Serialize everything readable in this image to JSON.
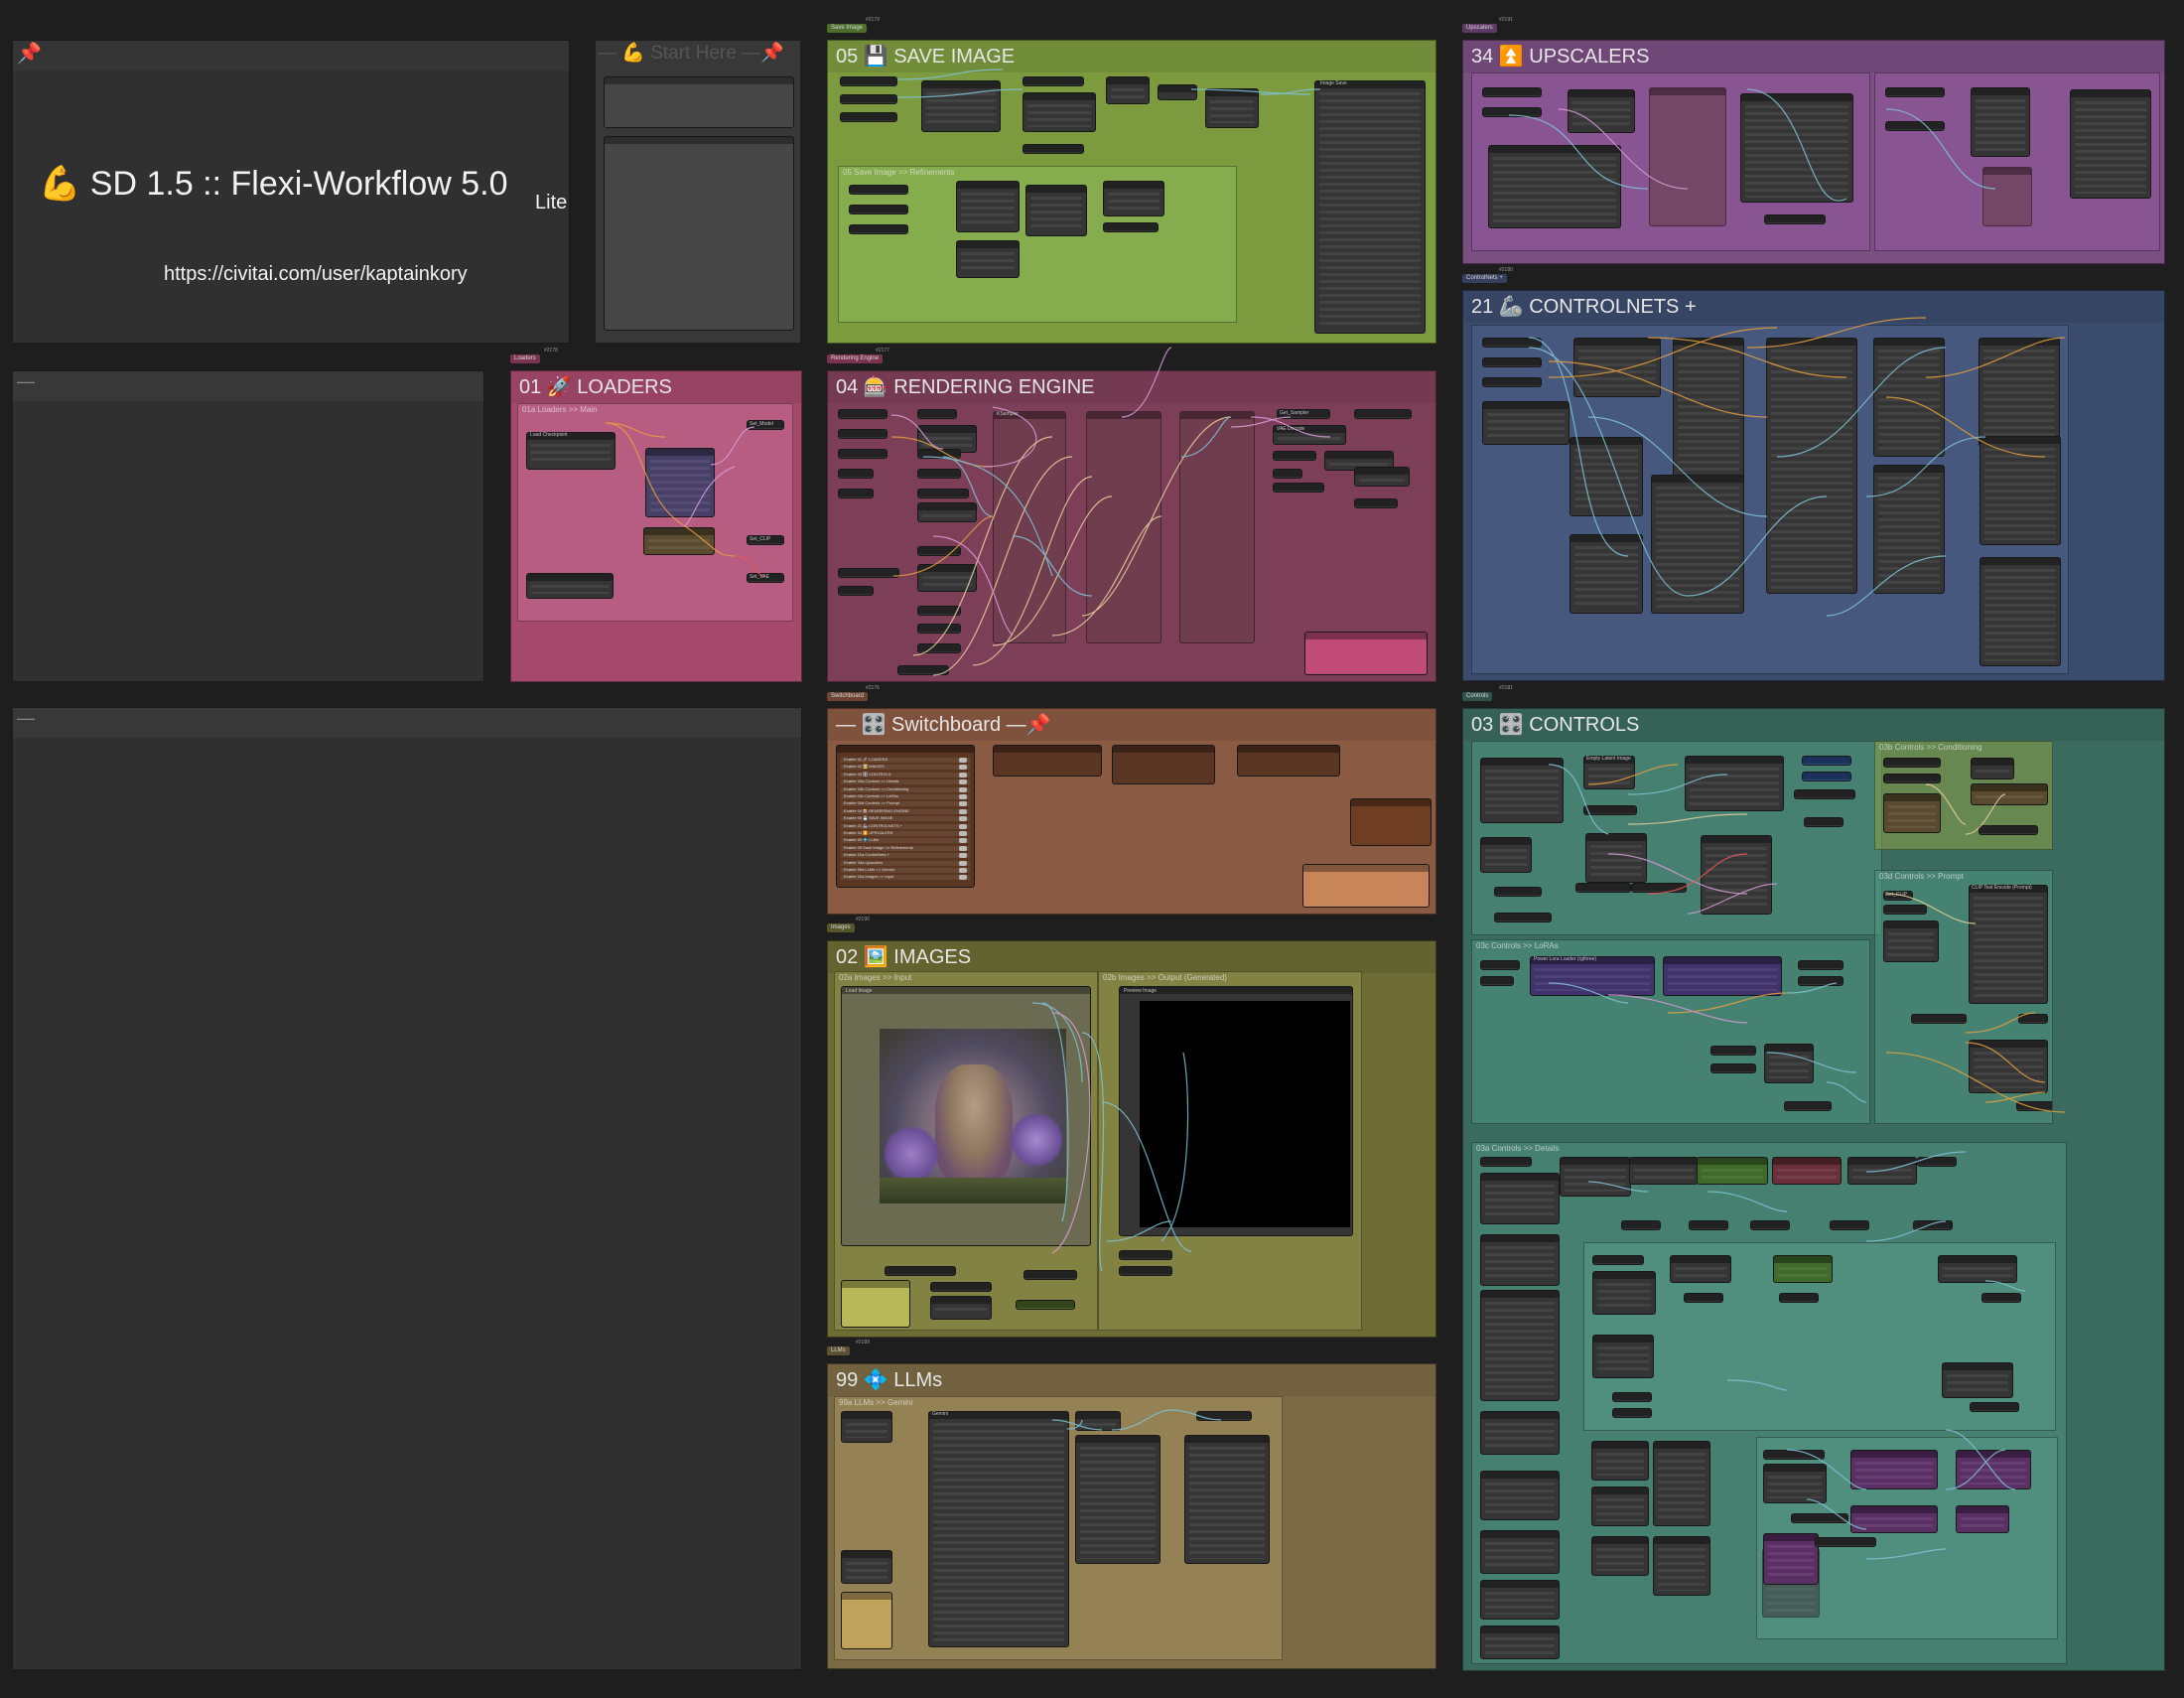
{
  "colors": {
    "canvas": "#1e1e1e",
    "dark_group": "#353535",
    "pink": "#a4496a",
    "green": "#7c9a3e",
    "purple": "#7a4f82",
    "blue": "#3b4b6c",
    "brown": "#8a5a43",
    "olive": "#6c6c34",
    "tan": "#7b6a44",
    "teal": "#3b6a5e"
  },
  "notes": {
    "pin_icon": "📌",
    "title": "💪 SD 1.5 :: Flexi-Workflow 5.0",
    "badge": "Lite",
    "url": "https://civitai.com/user/kaptainkory",
    "start_here": "— 💪 Start Here —📌",
    "dash1": "—",
    "dash2": "—"
  },
  "groups": {
    "save_image": "05 💾 SAVE IMAGE",
    "upscalers": "34 ⏫ UPSCALERS",
    "controlnets": "21 🦾 CONTROLNETS +",
    "loaders": "01 🚀 LOADERS",
    "rendering": "04 🎰 RENDERING ENGINE",
    "switchboard": "— 🎛️ Switchboard —📌",
    "controls": "03 🎛️ CONTROLS",
    "images": "02 🖼️ IMAGES",
    "llms": "99 💠 LLMs"
  },
  "tags": {
    "save_image": "Save Image",
    "upscalers": "Upscalers",
    "controlnets": "ControlNets +",
    "loaders": "Loaders",
    "rendering": "Rendering Engine",
    "switchboard": "Switchboard",
    "controls": "Controls",
    "images": "Images",
    "llms": "LLMs"
  },
  "subgroups": {
    "save_refinements": "05 Save Image >> Refinements",
    "loaders_main": "01a Loaders >> Main",
    "images_input": "02a Images >> Input",
    "images_output": "02b Images >> Output (Generated)",
    "llms_gemini": "99a LLMs >> Gemini",
    "controls_details": "03a Controls >> Details",
    "controls_conditioning": "03b Controls >> Conditioning",
    "controls_prompt": "03d Controls >> Prompt",
    "controls_loras": "03c Controls >> LoRAs"
  },
  "labels": {
    "get_model": "Get_Model",
    "get_clip": "Get_CLIP",
    "get_vae": "Get_VAE",
    "set_model": "Set_Model",
    "set_clip": "Set_CLIP",
    "set_vae": "Set_VAE",
    "get_image_saved": "Get_Image::saved",
    "get_image_generated": "Get_Image::generated",
    "get_latent": "Get_Latent",
    "get_seed": "Get_Seed",
    "get_cfg": "Get_CFG",
    "get_cond_pos": "Get_Cond_++ Prompt",
    "get_cond_neg": "Get_Cond_-- Prompt",
    "get_sampler": "Get_Sampler",
    "get_scheduler": "Get_Scheduler",
    "save_image": "Image Save",
    "vae_decode": "VAE Decode",
    "clip_text_encode": "CLIP Text Encode (Prompt)",
    "ksampler": "KSampler",
    "upscale_model": "Load Upscale Model",
    "controlnet_apply": "Apply ControlNet",
    "lora_loader": "Power Lora Loader (rgthree)",
    "checkpoint": "Load Checkpoint",
    "empty_latent": "Empty Latent Image",
    "preview_image": "Preview Image",
    "load_image": "Load Image",
    "gemini": "Gemini",
    "text": "Text"
  },
  "switchboard_rows": [
    "Enable 01 🚀 LOADERS",
    "Enable 02 🖼️ IMAGES",
    "Enable 03 🎛️ CONTROLS",
    "Enable 03a Controls >> Details",
    "Enable 03b Controls >> Conditioning",
    "Enable 03c Controls >> LoRAs",
    "Enable 03d Controls >> Prompt",
    "Enable 04 🎰 RENDERING ENGINE",
    "Enable 05 💾 SAVE IMAGE",
    "Enable 21 🦾 CONTROLNETS +",
    "Enable 34 ⏫ UPSCALERS",
    "Enable 99 💠 LLMs",
    "Enable 05 Save Image >> Refinements",
    "Enable 21a ControlNets +",
    "Enable 34a Upscalers",
    "Enable 99a LLMs >> Gemini",
    "Enable 02a Images >> Input"
  ]
}
